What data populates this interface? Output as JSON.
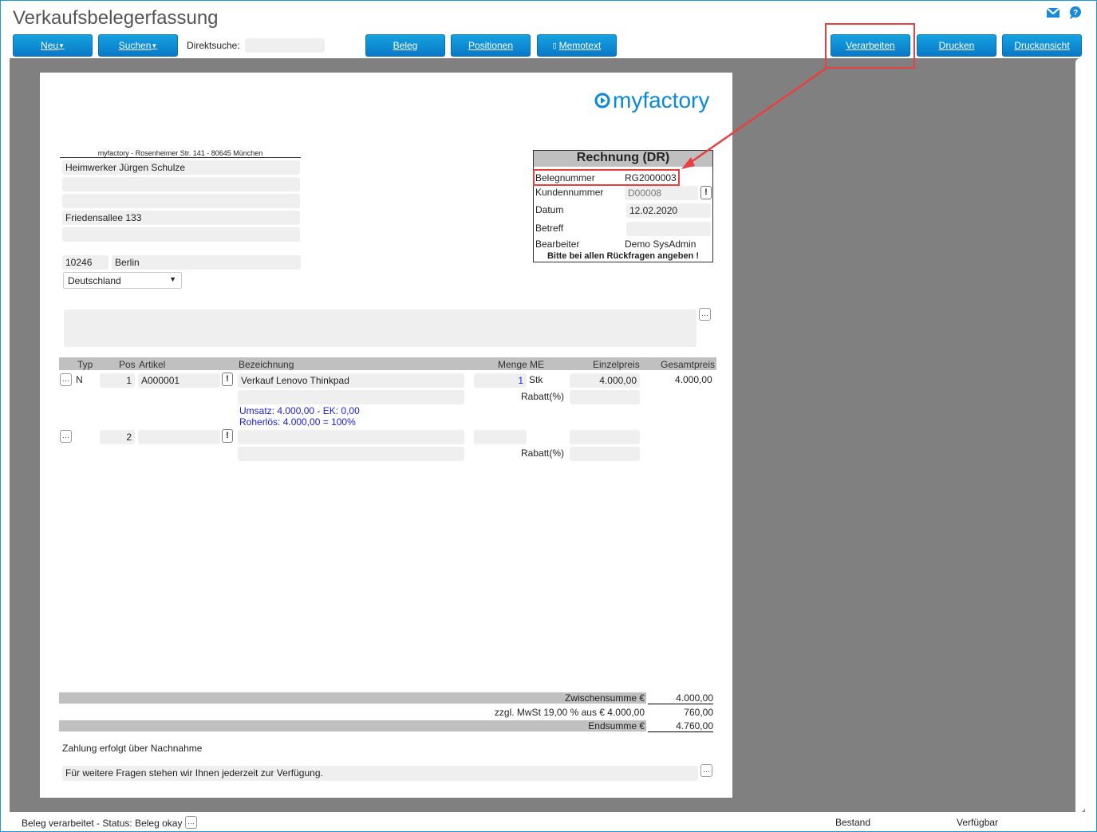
{
  "header": {
    "title": "Verkaufsbelegerfassung",
    "mail_icon": "mail-icon",
    "help_icon": "help-icon"
  },
  "toolbar": {
    "new": "Neu",
    "search": "Suchen",
    "direct_search_label": "Direktsuche:",
    "direct_search_value": "",
    "beleg": "Beleg",
    "positionen": "Positionen",
    "memotext": "Memotext",
    "verarbeiten": "Verarbeiten",
    "drucken": "Drucken",
    "druckansicht": "Druckansicht"
  },
  "document": {
    "logo": "myfactory",
    "sender_line": "myfactory - Rosenheimer Str. 141 - 80645 München",
    "address": {
      "line1": "Heimwerker Jürgen Schulze",
      "line2": "",
      "line3": "",
      "street": "Friedensallee 133",
      "line5": "",
      "zip": "10246",
      "city": "Berlin",
      "country": "Deutschland"
    },
    "info": {
      "title": "Rechnung (DR)",
      "belegnummer_label": "Belegnummer",
      "belegnummer": "RG2000003",
      "kundennummer_label": "Kundennummer",
      "kundennummer": "D00008",
      "datum_label": "Datum",
      "datum": "12.02.2020",
      "betreff_label": "Betreff",
      "betreff": "",
      "bearbeiter_label": "Bearbeiter",
      "bearbeiter": "Demo SysAdmin",
      "note": "Bitte bei allen Rückfragen angeben !"
    },
    "columns": {
      "typ": "Typ",
      "pos": "Pos",
      "artikel": "Artikel",
      "bezeichnung": "Bezeichnung",
      "menge_me": "Menge ME",
      "einzelpreis": "Einzelpreis",
      "gesamtpreis": "Gesamtpreis"
    },
    "rows": [
      {
        "typ": "N",
        "pos": "1",
        "artikel": "A000001",
        "bezeichnung": "Verkauf Lenovo Thinkpad",
        "menge": "1",
        "me": "Stk",
        "einzelpreis": "4.000,00",
        "gesamtpreis": "4.000,00",
        "rabatt_label": "Rabatt(%)",
        "umsatz": "Umsatz: 4.000,00 - EK: 0,00",
        "roherloes": "Roherlös: 4.000,00 = 100%"
      },
      {
        "typ": "",
        "pos": "2",
        "artikel": "",
        "bezeichnung": "",
        "menge": "",
        "me": "",
        "einzelpreis": "",
        "gesamtpreis": "",
        "rabatt_label": "Rabatt(%)"
      }
    ],
    "totals": {
      "zwischensumme_label": "Zwischensumme €",
      "zwischensumme": "4.000,00",
      "mwst_label": "zzgl. MwSt  19,00 % aus € 4.000,00",
      "mwst": "760,00",
      "endsumme_label": "Endsumme €",
      "endsumme": "4.760,00"
    },
    "payment": "Zahlung erfolgt über Nachnahme",
    "footer_text": "Für weitere Fragen stehen wir Ihnen jederzeit zur Verfügung."
  },
  "statusbar": {
    "status": "Beleg verarbeitet - Status: Beleg okay",
    "bestand": "Bestand",
    "verfuegbar": "Verfügbar"
  },
  "colors": {
    "accent": "#0a8ad6",
    "highlight": "#e84040"
  }
}
